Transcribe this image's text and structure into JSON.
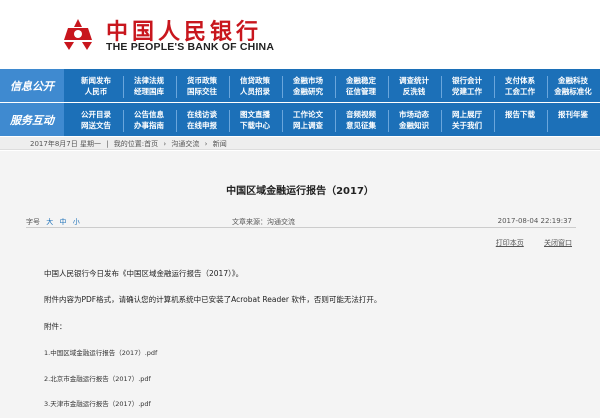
{
  "header": {
    "logo_cn": "中国人民银行",
    "logo_en": "THE PEOPLE'S BANK OF CHINA"
  },
  "nav": {
    "row1_title": "信息公开",
    "row1": [
      [
        "新闻发布",
        "人民币"
      ],
      [
        "法律法规",
        "经理国库"
      ],
      [
        "货币政策",
        "国际交往"
      ],
      [
        "信贷政策",
        "人员招录"
      ],
      [
        "金融市场",
        "金融研究"
      ],
      [
        "金融稳定",
        "征信管理"
      ],
      [
        "调查统计",
        "反洗钱"
      ],
      [
        "银行会计",
        "党建工作"
      ],
      [
        "支付体系",
        "工会工作"
      ],
      [
        "金融科技",
        "金融标准化"
      ]
    ],
    "row2_title": "服务互动",
    "row2": [
      [
        "公开目录",
        "网送文告"
      ],
      [
        "公告信息",
        "办事指南"
      ],
      [
        "在线访谈",
        "在线申报"
      ],
      [
        "图文直播",
        "下载中心"
      ],
      [
        "工作论文",
        "网上调查"
      ],
      [
        "音频视频",
        "意见征集"
      ],
      [
        "市场动态",
        "金融知识"
      ],
      [
        "网上展厅",
        "关于我们"
      ],
      [
        "报告下载",
        ""
      ],
      [
        "报刊年鉴",
        ""
      ]
    ]
  },
  "breadcrumb": {
    "date": "2017年8月7日 星期一",
    "location": "我的位置:首页",
    "c1": "沟通交流",
    "c2": "新闻"
  },
  "article": {
    "title": "中国区域金融运行报告（2017）",
    "font_label": "字号",
    "font_large": "大",
    "font_mid": "中",
    "font_small": "小",
    "source": "文章来源：沟通交流",
    "date": "2017-08-04 22:19:37",
    "print": "打印本页",
    "close": "关闭窗口",
    "p1": "中国人民银行今日发布《中国区域金融运行报告（2017）》。",
    "p2": "附件内容为PDF格式，请确认您的计算机系统中已安装了Acrobat Reader 软件，否则可能无法打开。",
    "p3": "附件：",
    "att1": "1.中国区域金融运行报告（2017）.pdf",
    "att2": "2.北京市金融运行报告（2017）.pdf",
    "att3": "3.天津市金融运行报告（2017）.pdf"
  }
}
